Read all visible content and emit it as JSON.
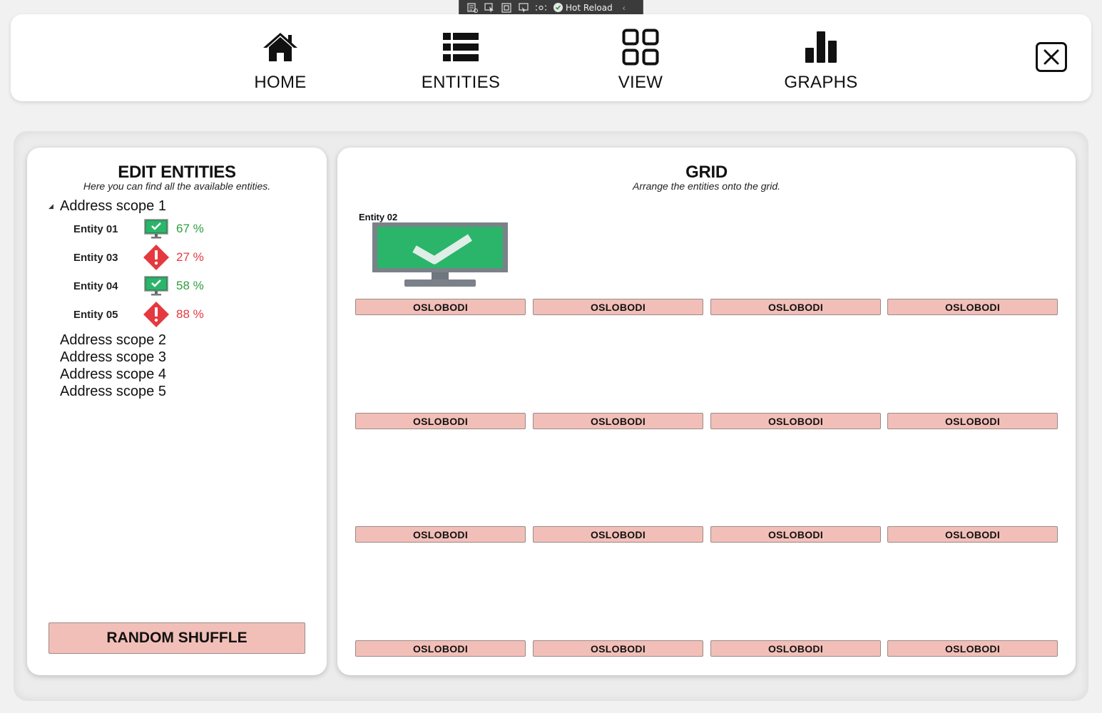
{
  "debug_toolbar": {
    "icons": [
      "live-visual-tree-icon",
      "select-element-icon",
      "display-layout-icon",
      "track-focus-icon",
      "binding-failures-icon"
    ],
    "hot_reload_label": "Hot Reload"
  },
  "nav": {
    "items": [
      {
        "label": "HOME",
        "icon": "home-icon"
      },
      {
        "label": "ENTITIES",
        "icon": "list-icon"
      },
      {
        "label": "VIEW",
        "icon": "grid-view-icon"
      },
      {
        "label": "GRAPHS",
        "icon": "bar-chart-icon"
      }
    ],
    "close_icon": "close-icon"
  },
  "left_panel": {
    "title": "EDIT ENTITIES",
    "subtitle": "Here you can find all the available entities.",
    "scopes": [
      {
        "label": "Address scope 1",
        "expanded": true,
        "entities": [
          {
            "name": "Entity 01",
            "status": "ok",
            "percent": "67 %"
          },
          {
            "name": "Entity 03",
            "status": "error",
            "percent": "27 %"
          },
          {
            "name": "Entity 04",
            "status": "ok",
            "percent": "58 %"
          },
          {
            "name": "Entity 05",
            "status": "error",
            "percent": "88 %"
          }
        ]
      },
      {
        "label": "Address scope 2",
        "expanded": false
      },
      {
        "label": "Address scope 3",
        "expanded": false
      },
      {
        "label": "Address scope 4",
        "expanded": false
      },
      {
        "label": "Address scope 5",
        "expanded": false
      }
    ],
    "shuffle_label": "RANDOM SHUFFLE"
  },
  "right_panel": {
    "title": "GRID",
    "subtitle": "Arrange the entities onto the grid.",
    "placed_entity": {
      "name": "Entity 02",
      "status": "ok"
    },
    "cell_button_label": "OSLOBODI"
  },
  "colors": {
    "ok": "#2e9e3e",
    "error": "#e53940",
    "button_bg": "#f2bfb8",
    "monitor_green": "#2bb56a"
  }
}
